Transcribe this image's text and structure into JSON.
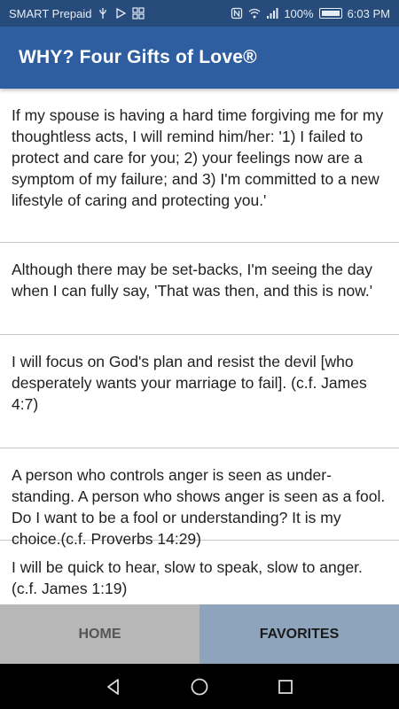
{
  "status_bar": {
    "carrier": "SMART Prepaid",
    "battery_percent": "100%",
    "time": "6:03 PM",
    "icons": [
      "usb-icon",
      "play-store-icon",
      "gallery-icon",
      "nfc-icon",
      "wifi-icon",
      "signal-icon",
      "battery-icon"
    ]
  },
  "app_bar": {
    "title": "WHY? Four Gifts of Love®"
  },
  "list": {
    "items": [
      {
        "text": "If my spouse is having a hard time forgiving me for my thoughtless acts, I will remind him/her: '1) I failed to protect and care for you; 2) your feelings now are a symptom of my failure; and 3) I'm committed to a new lifestyle of caring and protecting you.'"
      },
      {
        "text": "Although there may be set-backs, I'm seeing the day when I can fully say, 'That was then, and this is now.'"
      },
      {
        "text": "I will focus on God's plan and resist the devil [who desperately wants your marriage to fail]. (c.f. James 4:7)"
      },
      {
        "text": "A person who controls anger is seen as under-standing. A person who shows anger is seen as a fool. Do I want to be a fool or understanding? It is my choice.(c.f. Proverbs 14:29)"
      },
      {
        "text": "I will be quick to hear, slow to speak, slow to anger. (c.f. James 1:19)"
      }
    ]
  },
  "tabs": {
    "home": "HOME",
    "favorites": "FAVORITES"
  },
  "nav": {
    "icons": [
      "back-icon",
      "home-circle-icon",
      "recents-icon"
    ]
  },
  "colors": {
    "status_bar": "#274b7a",
    "app_bar": "#2e5ea0",
    "tab_home": "#b7b7b7",
    "tab_favorites": "#8ea4bc"
  }
}
